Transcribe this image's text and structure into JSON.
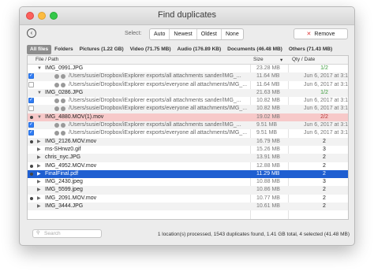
{
  "window": {
    "title": "Find duplicates"
  },
  "toolbar": {
    "select_label": "Select:",
    "select_options": [
      "Auto",
      "Newest",
      "Oldest",
      "None"
    ],
    "remove_label": "Remove"
  },
  "tabs": [
    "All files",
    "Folders",
    "Pictures (1.22 GB)",
    "Video (71.75 MB)",
    "Audio (176.89 KB)",
    "Documents (46.48 MB)",
    "Others (71.43 MB)"
  ],
  "columns": {
    "name": "File / Path",
    "size": "Size",
    "qty": "Qty / Date"
  },
  "rows": [
    {
      "kind": "group",
      "name": "IMG_0991.JPG",
      "size": "23.28 MB",
      "qty": "1/2",
      "qty_color": "#3a9a3a",
      "expanded": true,
      "check": "none",
      "style": "",
      "indent": 0
    },
    {
      "kind": "path",
      "name": "/Users/susie/Dropbox/iExplorer exports/all attachments sander/IMG_...",
      "size": "11.64 MB",
      "date": "Jun 6, 2017 at 3:15 PM",
      "check": "on",
      "style": "alt"
    },
    {
      "kind": "path",
      "name": "/Users/susie/Dropbox/iExplorer exports/everyone all attachments/IMG_...",
      "size": "11.64 MB",
      "date": "Jun 6, 2017 at 3:15 PM",
      "check": "off",
      "style": ""
    },
    {
      "kind": "group",
      "name": "IMG_0286.JPG",
      "size": "21.63 MB",
      "qty": "1/2",
      "qty_color": "#3a9a3a",
      "expanded": true,
      "check": "none",
      "style": "alt",
      "indent": 0
    },
    {
      "kind": "path",
      "name": "/Users/susie/Dropbox/iExplorer exports/all attachments sander/IMG_...",
      "size": "10.82 MB",
      "date": "Jun 6, 2017 at 3:15 PM",
      "check": "on",
      "style": ""
    },
    {
      "kind": "path",
      "name": "/Users/susie/Dropbox/iExplorer exports/everyone all attachments/IMG_...",
      "size": "10.82 MB",
      "date": "Jun 6, 2017 at 3:15 PM",
      "check": "off",
      "style": "alt"
    },
    {
      "kind": "group",
      "name": "IMG_4880.MOV(1).mov",
      "size": "19.02 MB",
      "qty": "2/2",
      "qty_color": "#b33333",
      "expanded": true,
      "check": "dot",
      "style": "pink",
      "indent": 0
    },
    {
      "kind": "path",
      "name": "/Users/susie/Dropbox/iExplorer exports/all attachments sander/IMG_...",
      "size": "9.51 MB",
      "date": "Jun 6, 2017 at 3:15 PM",
      "check": "on",
      "style": "alt"
    },
    {
      "kind": "path",
      "name": "/Users/susie/Dropbox/iExplorer exports/everyone all attachments/IMG_...",
      "size": "9.51 MB",
      "date": "Jun 6, 2017 at 3:15 PM",
      "check": "on",
      "style": ""
    },
    {
      "kind": "group",
      "name": "IMG_2126.MOV.mov",
      "size": "16.79 MB",
      "qty": "2",
      "qty_color": "#222222",
      "expanded": false,
      "check": "dot",
      "style": "alt",
      "indent": 0
    },
    {
      "kind": "group",
      "name": "ms-SHrwz0.gif",
      "size": "15.26 MB",
      "qty": "3",
      "qty_color": "#222222",
      "expanded": false,
      "check": "none",
      "style": "",
      "indent": 0
    },
    {
      "kind": "group",
      "name": "chris_nyc.JPG",
      "size": "13.91 MB",
      "qty": "2",
      "qty_color": "#222222",
      "expanded": false,
      "check": "none",
      "style": "alt",
      "indent": 0
    },
    {
      "kind": "group",
      "name": "IMG_4952.MOV.mov",
      "size": "12.88 MB",
      "qty": "2",
      "qty_color": "#222222",
      "expanded": false,
      "check": "dot",
      "style": "",
      "indent": 0
    },
    {
      "kind": "group",
      "name": "FinalFinal.pdf",
      "size": "11.29 MB",
      "qty": "2",
      "qty_color": "#ffffff",
      "expanded": false,
      "check": "dot",
      "style": "blue",
      "indent": 0
    },
    {
      "kind": "group",
      "name": "IMG_2430.jpeg",
      "size": "10.88 MB",
      "qty": "3",
      "qty_color": "#222222",
      "expanded": false,
      "check": "none",
      "style": "",
      "indent": 0
    },
    {
      "kind": "group",
      "name": "IMG_5599.jpeg",
      "size": "10.86 MB",
      "qty": "2",
      "qty_color": "#222222",
      "expanded": false,
      "check": "none",
      "style": "alt",
      "indent": 0
    },
    {
      "kind": "group",
      "name": "IMG_2091.MOV.mov",
      "size": "10.77 MB",
      "qty": "2",
      "qty_color": "#222222",
      "expanded": false,
      "check": "dot",
      "style": "",
      "indent": 0
    },
    {
      "kind": "group",
      "name": "IMG_3444.JPG",
      "size": "10.61 MB",
      "qty": "2",
      "qty_color": "#222222",
      "expanded": false,
      "check": "none",
      "style": "alt",
      "indent": 0
    }
  ],
  "search": {
    "placeholder": "Search"
  },
  "status": "1 location(s) processed, 1543 duplicates found, 1.41 GB total, 4 selected (41.48 MB)"
}
